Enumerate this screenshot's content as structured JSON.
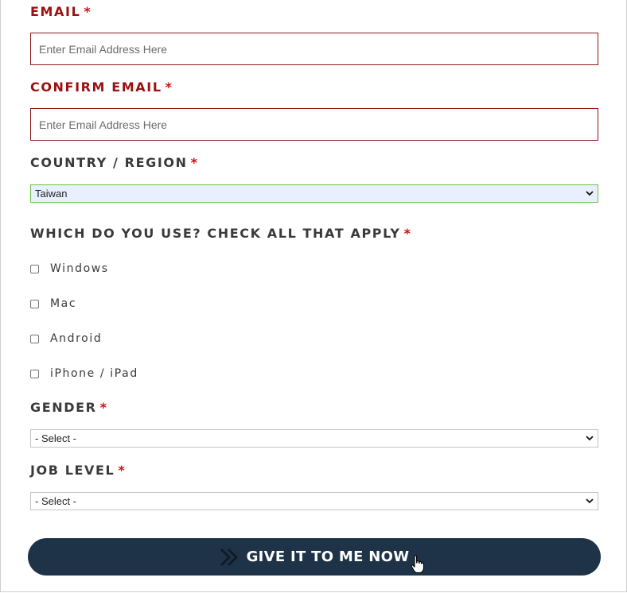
{
  "form": {
    "email": {
      "label": "EMAIL",
      "required_mark": "*",
      "placeholder": "Enter Email Address Here",
      "value": ""
    },
    "confirm_email": {
      "label": "CONFIRM EMAIL",
      "required_mark": "*",
      "placeholder": "Enter Email Address Here",
      "value": ""
    },
    "country": {
      "label": "COUNTRY / REGION",
      "required_mark": "*",
      "selected": "Taiwan"
    },
    "platforms": {
      "label": "WHICH DO YOU USE? CHECK ALL THAT APPLY",
      "required_mark": "*",
      "options": [
        {
          "label": "Windows",
          "checked": false
        },
        {
          "label": "Mac",
          "checked": false
        },
        {
          "label": "Android",
          "checked": false
        },
        {
          "label": "iPhone / iPad",
          "checked": false
        }
      ]
    },
    "gender": {
      "label": "GENDER",
      "required_mark": "*",
      "selected": "- Select -"
    },
    "job_level": {
      "label": "JOB LEVEL",
      "required_mark": "*",
      "selected": "- Select -"
    },
    "submit_label": "GIVE IT TO ME NOW"
  },
  "colors": {
    "error_label": "#9b1111",
    "required_mark": "#cc1111",
    "label": "#3a3a3a",
    "error_border": "#8b1a1a",
    "valid_border": "#6fbf4a",
    "autofill_bg": "#e8f0fe",
    "button_bg": "#1e3348"
  },
  "icons": {
    "select_arrow": "chevron-down-icon",
    "button_arrow": "double-chevron-right-icon",
    "cursor": "hand-pointer-cursor"
  }
}
